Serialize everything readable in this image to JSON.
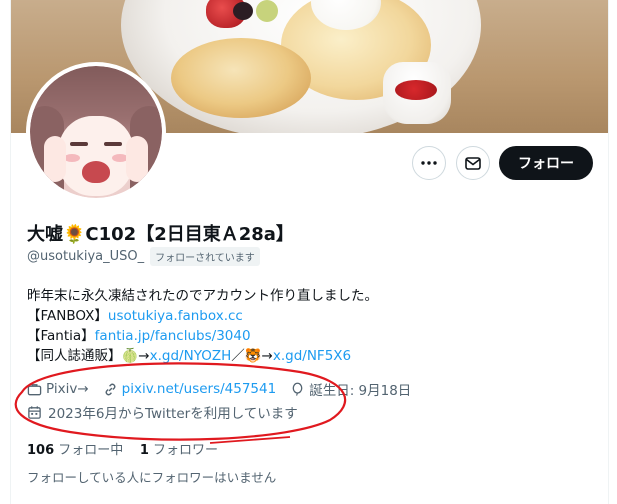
{
  "profile": {
    "display_name": "大嘘🌻C102【2日目東Ａ28a】",
    "handle": "@usotukiya_USO_",
    "follows_you_badge": "フォローされています",
    "bio_lines": [
      {
        "text": "昨年末に永久凍結されたのでアカウント作り直しました。"
      },
      {
        "prefix": "【FANBOX】",
        "link": "usotukiya.fanbox.cc"
      },
      {
        "prefix": "【Fantia】",
        "link": "fantia.jp/fanclubs/3040"
      },
      {
        "prefix": "【同人誌通販】🍈→",
        "link": "x.gd/NYOZH",
        "mid": "／🐯→",
        "link2": "x.gd/NF5X6"
      }
    ],
    "meta": {
      "category": "Pixiv→",
      "website": "pixiv.net/users/457541",
      "birthday": "誕生日: 9月18日",
      "joined": "2023年6月からTwitterを利用しています"
    },
    "stats": {
      "following_count": "106",
      "following_label": "フォロー中",
      "followers_count": "1",
      "followers_label": "フォロワー"
    },
    "no_mutual_followers": "フォローしている人にフォロワーはいません"
  },
  "actions": {
    "more_icon": "more-icon",
    "message_icon": "envelope-icon",
    "follow_label": "フォロー"
  },
  "colors": {
    "accent": "#1d9bf0",
    "text": "#0f1419",
    "muted": "#536471",
    "annotation": "#e0191f"
  }
}
